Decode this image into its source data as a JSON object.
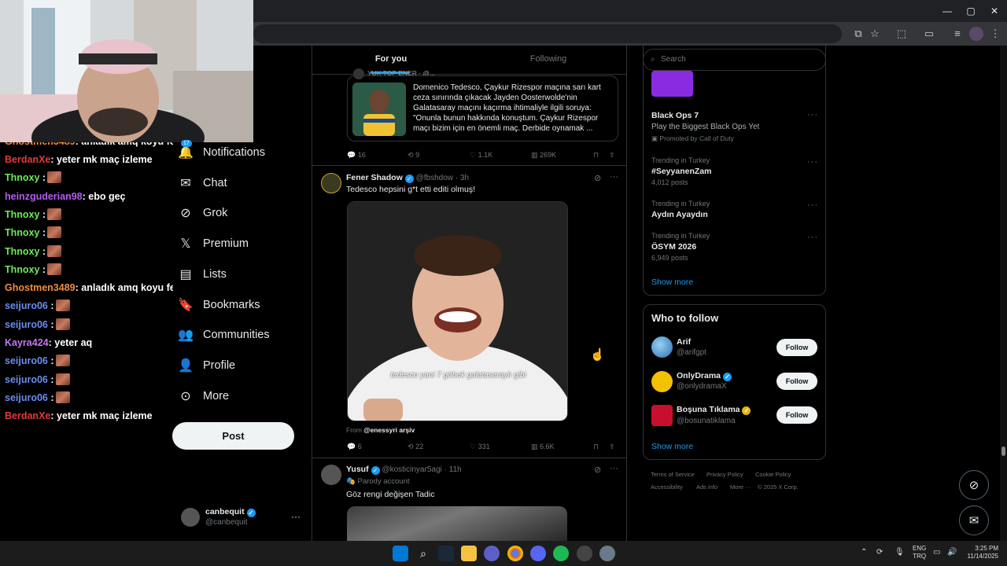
{
  "chat": {
    "lines": [
      {
        "user": "Ghostmen3489",
        "color": "#f08c3c",
        "msg": ": anladık amq koyu fenerlisin",
        "emote": false
      },
      {
        "user": "BerdanXe",
        "color": "#e03b3b",
        "msg": ": yeter mk maç izleme",
        "emote": false
      },
      {
        "user": "Thnoxy",
        "color": "#6fe85a",
        "msg": " :",
        "emote": true
      },
      {
        "user": "heinzguderian98",
        "color": "#b55bf0",
        "msg": ": ebo geç",
        "emote": false
      },
      {
        "user": "Thnoxy",
        "color": "#6fe85a",
        "msg": " :",
        "emote": true
      },
      {
        "user": "Thnoxy",
        "color": "#6fe85a",
        "msg": " :",
        "emote": true
      },
      {
        "user": "Thnoxy",
        "color": "#6fe85a",
        "msg": " :",
        "emote": true
      },
      {
        "user": "Thnoxy",
        "color": "#6fe85a",
        "msg": " :",
        "emote": true
      },
      {
        "user": "Ghostmen3489",
        "color": "#f08c3c",
        "msg": ": anladık amq koyu fenerlisin",
        "emote": false
      },
      {
        "user": "seijuro06",
        "color": "#6a8cf0",
        "msg": " :",
        "emote": true
      },
      {
        "user": "seijuro06",
        "color": "#6a8cf0",
        "msg": " :",
        "emote": true
      },
      {
        "user": "Kayra424",
        "color": "#c776f0",
        "msg": ": yeter aq",
        "emote": false
      },
      {
        "user": "seijuro06",
        "color": "#6a8cf0",
        "msg": " :",
        "emote": true
      },
      {
        "user": "seijuro06",
        "color": "#6a8cf0",
        "msg": " :",
        "emote": true
      },
      {
        "user": "seijuro06",
        "color": "#6a8cf0",
        "msg": " :",
        "emote": true
      },
      {
        "user": "BerdanXe",
        "color": "#e03b3b",
        "msg": ": yeter mk maç izleme",
        "emote": false
      }
    ]
  },
  "nav": {
    "notifications_badge": "17",
    "notifications": "Notifications",
    "chat": "Chat",
    "grok": "Grok",
    "premium": "Premium",
    "lists": "Lists",
    "bookmarks": "Bookmarks",
    "communities": "Communities",
    "profile": "Profile",
    "more": "More",
    "post": "Post",
    "account_name": "canbequit",
    "account_handle": "@canbequit"
  },
  "tabs": {
    "for_you": "For you",
    "following": "Following"
  },
  "tweet1": {
    "header_partial": "YUK TOP ENER · @...",
    "text": "Domenico Tedesco, Çaykur Rizespor maçına sarı kart ceza sınırında çıkacak Jayden Oosterwolde'nin Galatasaray maçını kaçırma ihtimaliyle ilgili soruya: \"Onunla bunun hakkında konuştum. Çaykur Rizespor maçı bizim için en önemli maç. Derbide oynamak ...",
    "replies": "16",
    "reposts": "9",
    "likes": "1.1K",
    "views": "269K"
  },
  "tweet2": {
    "name": "Fener Shadow",
    "handle": "@fbshdow · 3h",
    "text": "Tedesco hepsini g*t etti editi olmuş!",
    "caption": "tedesco  yani 7 göbek galatasaraylı gibi",
    "from_label": "From",
    "from_account": "@enessyri arşiv",
    "replies": "6",
    "reposts": "22",
    "likes": "331",
    "views": "6.6K"
  },
  "tweet3": {
    "name": "Yusuf",
    "handle": "@kosticinyar5agi · 11h",
    "parody": "Parody account",
    "text": "Göz rengi değişen Tadic"
  },
  "search": {
    "placeholder": "Search"
  },
  "trends": {
    "promo_title": "Black Ops 7",
    "promo_sub": "Play the Biggest Black Ops Yet",
    "promo_by": "Promoted by Call of Duty",
    "items": [
      {
        "context": "Trending in Turkey",
        "name": "#SeyyanenZam",
        "posts": "4,012 posts"
      },
      {
        "context": "Trending in Turkey",
        "name": "Aydın Ayaydın",
        "posts": ""
      },
      {
        "context": "Trending in Turkey",
        "name": "ÖSYM 2026",
        "posts": "6,949 posts"
      }
    ],
    "show_more": "Show more"
  },
  "who_to_follow": {
    "title": "Who to follow",
    "users": [
      {
        "name": "Arif",
        "handle": "@arifgpt",
        "button": "Follow"
      },
      {
        "name": "OnlyDrama",
        "handle": "@onlydramaX",
        "button": "Follow"
      },
      {
        "name": "Boşuna Tıklama",
        "handle": "@bosunatiklama",
        "button": "Follow"
      }
    ],
    "show_more": "Show more"
  },
  "footer": {
    "terms": "Terms of Service",
    "privacy": "Privacy Policy",
    "cookie": "Cookie Policy",
    "accessibility": "Accessibility",
    "ads": "Ads info",
    "more": "More ···",
    "copyright": "© 2025 X Corp."
  },
  "taskbar": {
    "lang_top": "ENG",
    "lang_bottom": "TRQ",
    "time": "3:25 PM",
    "date": "11/14/2025"
  },
  "colors": {
    "accent": "#1d9bf0",
    "border": "#2f3336",
    "muted": "#71767b"
  }
}
